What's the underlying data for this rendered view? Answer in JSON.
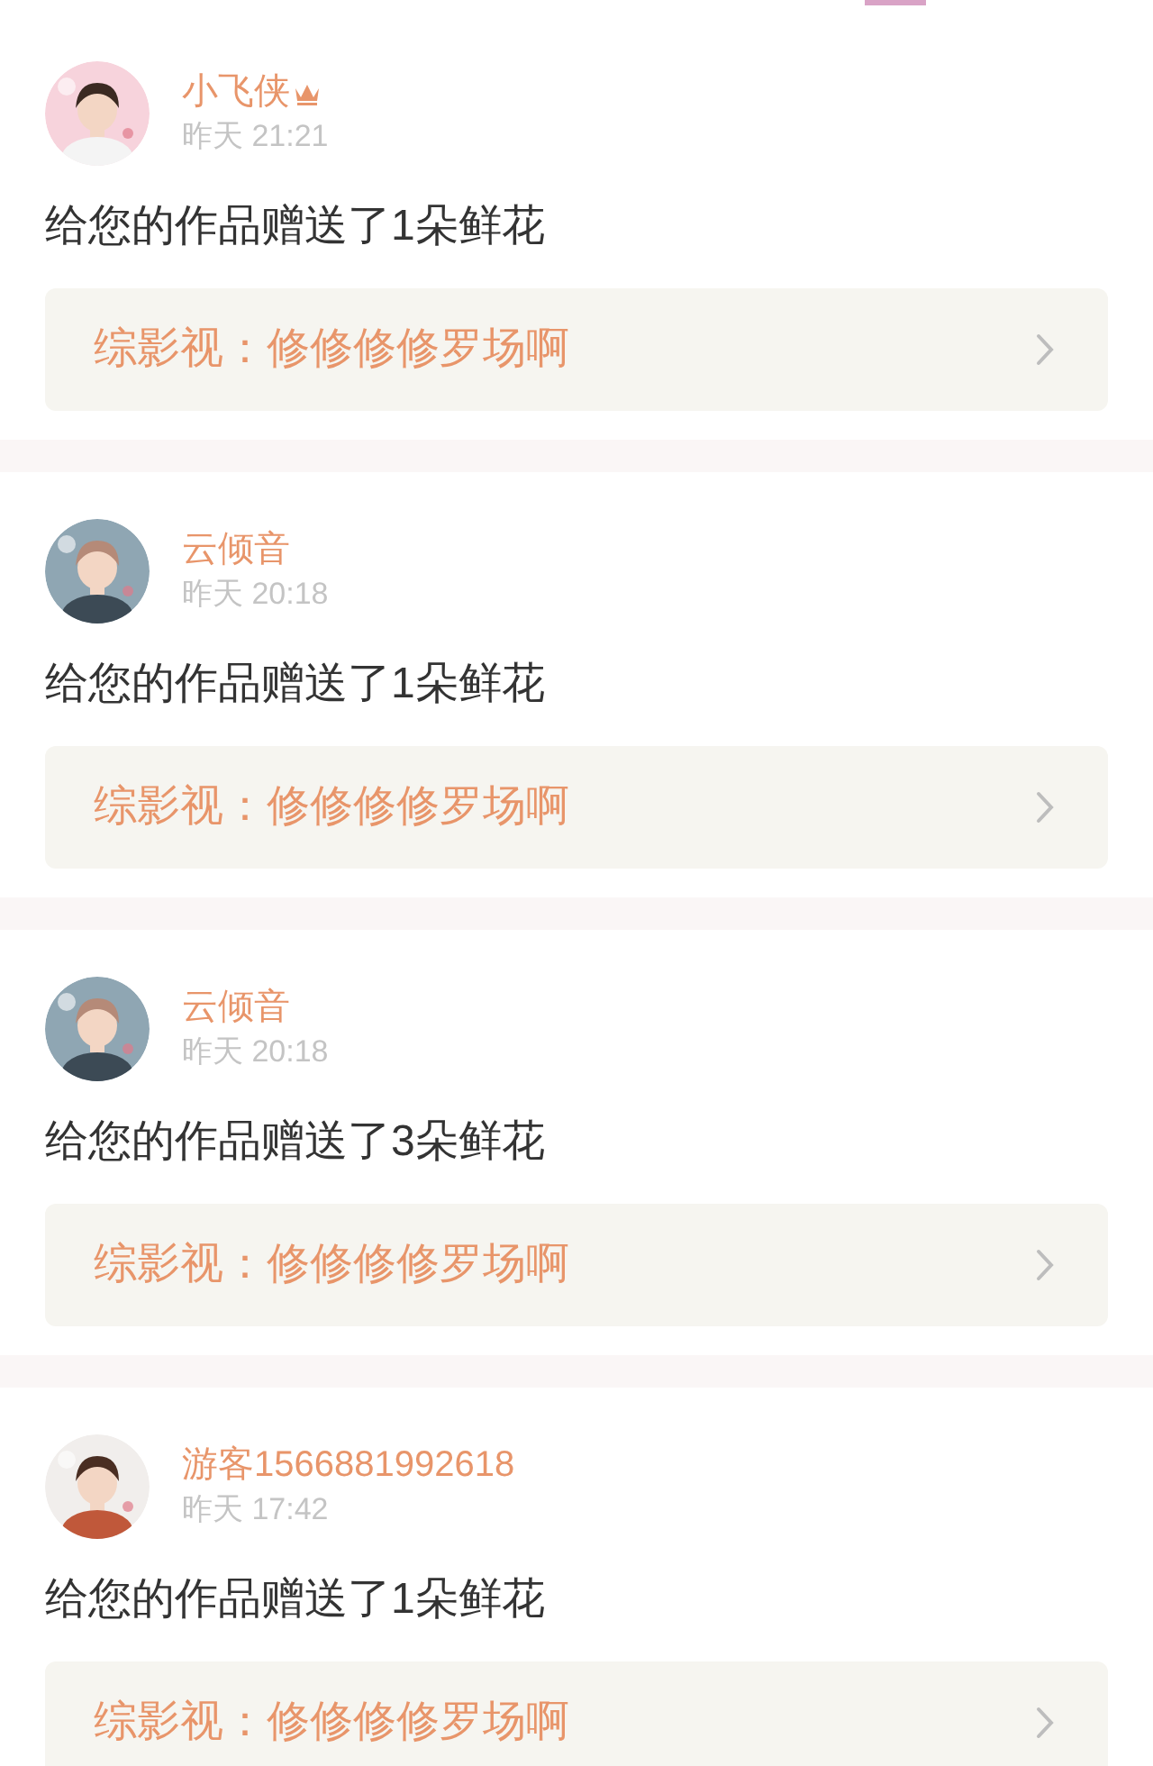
{
  "notifications": [
    {
      "user": {
        "name": "小飞侠",
        "vip": true
      },
      "time": "昨天 21:21",
      "message": "给您的作品赠送了1朵鲜花",
      "work": "综影视：修修修修罗场啊"
    },
    {
      "user": {
        "name": "云倾音",
        "vip": false
      },
      "time": "昨天 20:18",
      "message": "给您的作品赠送了1朵鲜花",
      "work": "综影视：修修修修罗场啊"
    },
    {
      "user": {
        "name": "云倾音",
        "vip": false
      },
      "time": "昨天 20:18",
      "message": "给您的作品赠送了3朵鲜花",
      "work": "综影视：修修修修罗场啊"
    },
    {
      "user": {
        "name": "游客1566881992618",
        "vip": false
      },
      "time": "昨天 17:42",
      "message": "给您的作品赠送了1朵鲜花",
      "work": "综影视：修修修修罗场啊"
    }
  ]
}
